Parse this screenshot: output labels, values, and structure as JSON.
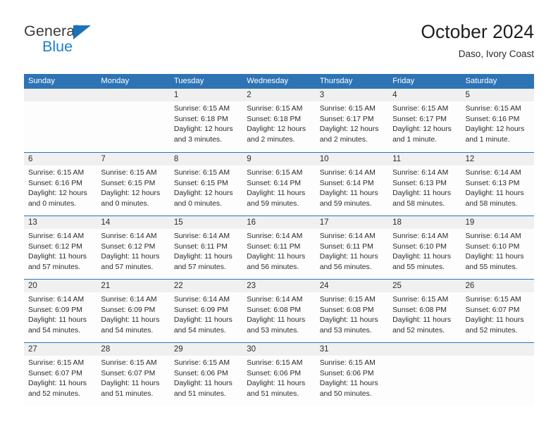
{
  "brand": {
    "name_part1": "General",
    "name_part2": "Blue",
    "triangle_color": "#1b72b8",
    "blue_color": "#1b80d0"
  },
  "header": {
    "month_title": "October 2024",
    "location": "Daso, Ivory Coast",
    "accent_color": "#2e74b5",
    "day_band_color": "#f0f0f0"
  },
  "weekdays": [
    "Sunday",
    "Monday",
    "Tuesday",
    "Wednesday",
    "Thursday",
    "Friday",
    "Saturday"
  ],
  "weeks": [
    [
      {
        "day": "",
        "lines": [
          "",
          "",
          "",
          ""
        ]
      },
      {
        "day": "",
        "lines": [
          "",
          "",
          "",
          ""
        ]
      },
      {
        "day": "1",
        "lines": [
          "Sunrise: 6:15 AM",
          "Sunset: 6:18 PM",
          "Daylight: 12 hours",
          "and 3 minutes."
        ]
      },
      {
        "day": "2",
        "lines": [
          "Sunrise: 6:15 AM",
          "Sunset: 6:18 PM",
          "Daylight: 12 hours",
          "and 2 minutes."
        ]
      },
      {
        "day": "3",
        "lines": [
          "Sunrise: 6:15 AM",
          "Sunset: 6:17 PM",
          "Daylight: 12 hours",
          "and 2 minutes."
        ]
      },
      {
        "day": "4",
        "lines": [
          "Sunrise: 6:15 AM",
          "Sunset: 6:17 PM",
          "Daylight: 12 hours",
          "and 1 minute."
        ]
      },
      {
        "day": "5",
        "lines": [
          "Sunrise: 6:15 AM",
          "Sunset: 6:16 PM",
          "Daylight: 12 hours",
          "and 1 minute."
        ]
      }
    ],
    [
      {
        "day": "6",
        "lines": [
          "Sunrise: 6:15 AM",
          "Sunset: 6:16 PM",
          "Daylight: 12 hours",
          "and 0 minutes."
        ]
      },
      {
        "day": "7",
        "lines": [
          "Sunrise: 6:15 AM",
          "Sunset: 6:15 PM",
          "Daylight: 12 hours",
          "and 0 minutes."
        ]
      },
      {
        "day": "8",
        "lines": [
          "Sunrise: 6:15 AM",
          "Sunset: 6:15 PM",
          "Daylight: 12 hours",
          "and 0 minutes."
        ]
      },
      {
        "day": "9",
        "lines": [
          "Sunrise: 6:15 AM",
          "Sunset: 6:14 PM",
          "Daylight: 11 hours",
          "and 59 minutes."
        ]
      },
      {
        "day": "10",
        "lines": [
          "Sunrise: 6:14 AM",
          "Sunset: 6:14 PM",
          "Daylight: 11 hours",
          "and 59 minutes."
        ]
      },
      {
        "day": "11",
        "lines": [
          "Sunrise: 6:14 AM",
          "Sunset: 6:13 PM",
          "Daylight: 11 hours",
          "and 58 minutes."
        ]
      },
      {
        "day": "12",
        "lines": [
          "Sunrise: 6:14 AM",
          "Sunset: 6:13 PM",
          "Daylight: 11 hours",
          "and 58 minutes."
        ]
      }
    ],
    [
      {
        "day": "13",
        "lines": [
          "Sunrise: 6:14 AM",
          "Sunset: 6:12 PM",
          "Daylight: 11 hours",
          "and 57 minutes."
        ]
      },
      {
        "day": "14",
        "lines": [
          "Sunrise: 6:14 AM",
          "Sunset: 6:12 PM",
          "Daylight: 11 hours",
          "and 57 minutes."
        ]
      },
      {
        "day": "15",
        "lines": [
          "Sunrise: 6:14 AM",
          "Sunset: 6:11 PM",
          "Daylight: 11 hours",
          "and 57 minutes."
        ]
      },
      {
        "day": "16",
        "lines": [
          "Sunrise: 6:14 AM",
          "Sunset: 6:11 PM",
          "Daylight: 11 hours",
          "and 56 minutes."
        ]
      },
      {
        "day": "17",
        "lines": [
          "Sunrise: 6:14 AM",
          "Sunset: 6:11 PM",
          "Daylight: 11 hours",
          "and 56 minutes."
        ]
      },
      {
        "day": "18",
        "lines": [
          "Sunrise: 6:14 AM",
          "Sunset: 6:10 PM",
          "Daylight: 11 hours",
          "and 55 minutes."
        ]
      },
      {
        "day": "19",
        "lines": [
          "Sunrise: 6:14 AM",
          "Sunset: 6:10 PM",
          "Daylight: 11 hours",
          "and 55 minutes."
        ]
      }
    ],
    [
      {
        "day": "20",
        "lines": [
          "Sunrise: 6:14 AM",
          "Sunset: 6:09 PM",
          "Daylight: 11 hours",
          "and 54 minutes."
        ]
      },
      {
        "day": "21",
        "lines": [
          "Sunrise: 6:14 AM",
          "Sunset: 6:09 PM",
          "Daylight: 11 hours",
          "and 54 minutes."
        ]
      },
      {
        "day": "22",
        "lines": [
          "Sunrise: 6:14 AM",
          "Sunset: 6:09 PM",
          "Daylight: 11 hours",
          "and 54 minutes."
        ]
      },
      {
        "day": "23",
        "lines": [
          "Sunrise: 6:14 AM",
          "Sunset: 6:08 PM",
          "Daylight: 11 hours",
          "and 53 minutes."
        ]
      },
      {
        "day": "24",
        "lines": [
          "Sunrise: 6:15 AM",
          "Sunset: 6:08 PM",
          "Daylight: 11 hours",
          "and 53 minutes."
        ]
      },
      {
        "day": "25",
        "lines": [
          "Sunrise: 6:15 AM",
          "Sunset: 6:08 PM",
          "Daylight: 11 hours",
          "and 52 minutes."
        ]
      },
      {
        "day": "26",
        "lines": [
          "Sunrise: 6:15 AM",
          "Sunset: 6:07 PM",
          "Daylight: 11 hours",
          "and 52 minutes."
        ]
      }
    ],
    [
      {
        "day": "27",
        "lines": [
          "Sunrise: 6:15 AM",
          "Sunset: 6:07 PM",
          "Daylight: 11 hours",
          "and 52 minutes."
        ]
      },
      {
        "day": "28",
        "lines": [
          "Sunrise: 6:15 AM",
          "Sunset: 6:07 PM",
          "Daylight: 11 hours",
          "and 51 minutes."
        ]
      },
      {
        "day": "29",
        "lines": [
          "Sunrise: 6:15 AM",
          "Sunset: 6:06 PM",
          "Daylight: 11 hours",
          "and 51 minutes."
        ]
      },
      {
        "day": "30",
        "lines": [
          "Sunrise: 6:15 AM",
          "Sunset: 6:06 PM",
          "Daylight: 11 hours",
          "and 51 minutes."
        ]
      },
      {
        "day": "31",
        "lines": [
          "Sunrise: 6:15 AM",
          "Sunset: 6:06 PM",
          "Daylight: 11 hours",
          "and 50 minutes."
        ]
      },
      {
        "day": "",
        "lines": [
          "",
          "",
          "",
          ""
        ]
      },
      {
        "day": "",
        "lines": [
          "",
          "",
          "",
          ""
        ]
      }
    ]
  ]
}
